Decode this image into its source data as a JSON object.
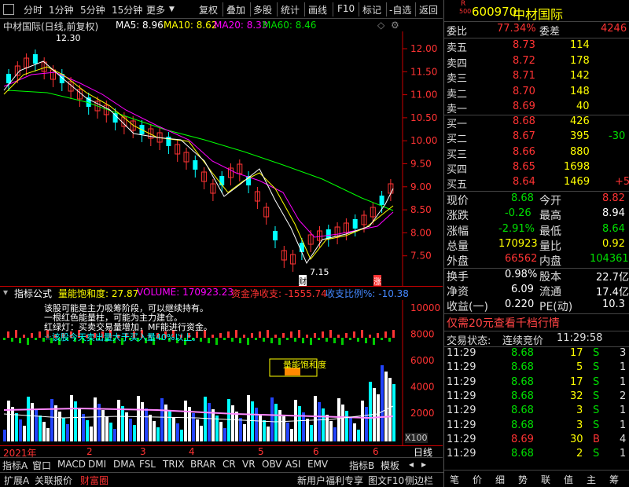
{
  "toolbar": {
    "periods": [
      "分时",
      "1分钟",
      "5分钟",
      "15分钟",
      "更多"
    ],
    "actions": [
      "复权",
      "叠加",
      "多股",
      "统计",
      "画线",
      "F10",
      "标记",
      "-自选",
      "返回"
    ]
  },
  "chart": {
    "stock_label": "中材国际(日线,前复权)",
    "ma5": "MA5: 8.96",
    "ma10": "MA10: 8.62",
    "ma20": "MA20: 8.33",
    "ma60": "MA60: 8.46",
    "high_note": "12.30",
    "low_note": "7.15",
    "fin_tag": "财",
    "up_tag": "涨",
    "y_ticks": [
      "12.00",
      "11.50",
      "11.00",
      "10.50",
      "10.00",
      "9.50",
      "9.00",
      "8.50",
      "8.00",
      "7.50"
    ],
    "dates": [
      "2021年",
      "2",
      "3",
      "4",
      "5",
      "6"
    ],
    "period": "日线",
    "colors": {
      "ma5": "#ffffff",
      "ma10": "#ffff00",
      "ma20": "#ff00ff",
      "ma60": "#00ff00",
      "up": "#ff3333",
      "down": "#00ffff"
    }
  },
  "chart_data": {
    "type": "candlestick",
    "series": [
      {
        "name": "MA5",
        "last": 8.96
      },
      {
        "name": "MA10",
        "last": 8.62
      },
      {
        "name": "MA20",
        "last": 8.33
      },
      {
        "name": "MA60",
        "last": 8.46
      }
    ],
    "high": 12.3,
    "low": 7.15,
    "ylim": [
      7.15,
      12.3
    ]
  },
  "indicator": {
    "label": "指标公式",
    "saturation": "量能饱和度: 27.87",
    "volume": "VOLUME: 170923.23",
    "netflow": "资金净收支: -1555.74",
    "ratio": "收支比例%: -10.38",
    "notes": [
      "该股可能是主力吸筹阶段，可以继续持有。",
      "一根红色能量柱，可能为主力建仓。",
      "红绿灯：买卖交易量增加，MF能进行资金。",
      "☆该股今天卖出量大于买入量40%以上。"
    ],
    "box_label": "量能饱和度",
    "y_ticks": [
      "10000",
      "8000",
      "6000",
      "4000",
      "2000"
    ],
    "unit": "X100"
  },
  "tabs": [
    "指标A",
    "窗口",
    "MACD",
    "DMI",
    "DMA",
    "FSL",
    "TRIX",
    "BRAR",
    "CR",
    "VR",
    "OBV",
    "ASI",
    "EMV"
  ],
  "tabs_right": [
    "指标B",
    "模板"
  ],
  "bottom": [
    "扩展A",
    "关联报价",
    "财富圈"
  ],
  "bottom_right": [
    "新用户福利专享",
    "图文F10",
    "侧边栏"
  ],
  "right": {
    "code": "600970",
    "name": "中材国际",
    "r_tag": "R",
    "num_tag": "500",
    "weibi_label": "委比",
    "weibi": "77.34%",
    "weicha_label": "委差",
    "weicha": "4246",
    "sell": [
      {
        "l": "卖五",
        "p": "8.73",
        "v": "114"
      },
      {
        "l": "卖四",
        "p": "8.72",
        "v": "178"
      },
      {
        "l": "卖三",
        "p": "8.71",
        "v": "142"
      },
      {
        "l": "卖二",
        "p": "8.70",
        "v": "148"
      },
      {
        "l": "卖一",
        "p": "8.69",
        "v": "40"
      }
    ],
    "buy": [
      {
        "l": "买一",
        "p": "8.68",
        "v": "426",
        "c": ""
      },
      {
        "l": "买二",
        "p": "8.67",
        "v": "395",
        "c": "-30"
      },
      {
        "l": "买三",
        "p": "8.66",
        "v": "880",
        "c": ""
      },
      {
        "l": "买四",
        "p": "8.65",
        "v": "1698",
        "c": ""
      },
      {
        "l": "买五",
        "p": "8.64",
        "v": "1469",
        "c": "+5"
      }
    ],
    "stats": [
      {
        "a": "现价",
        "b": "8.68",
        "c": "今开",
        "d": "8.82"
      },
      {
        "a": "涨跌",
        "b": "-0.26",
        "c": "最高",
        "d": "8.94"
      },
      {
        "a": "涨幅",
        "b": "-2.91%",
        "c": "最低",
        "d": "8.64"
      },
      {
        "a": "总量",
        "b": "170923",
        "c": "量比",
        "d": "0.92"
      },
      {
        "a": "外盘",
        "b": "66562",
        "c": "内盘",
        "d": "104361"
      }
    ],
    "stats2": [
      {
        "a": "换手",
        "b": "0.98%",
        "c": "股本",
        "d": "22.7亿"
      },
      {
        "a": "净资",
        "b": "6.09",
        "c": "流通",
        "d": "17.4亿"
      },
      {
        "a": "收益(一)",
        "b": "0.220",
        "c": "PE(动)",
        "d": "10.3"
      }
    ],
    "promo": "仅需20元查看千档行情",
    "status_label": "交易状态:",
    "status": "连续竞价",
    "time": "11:29:58",
    "ticks": [
      {
        "t": "11:29",
        "p": "8.68",
        "v": "17",
        "s": "S",
        "n": "3"
      },
      {
        "t": "11:29",
        "p": "8.68",
        "v": "5",
        "s": "S",
        "n": "1"
      },
      {
        "t": "11:29",
        "p": "8.68",
        "v": "17",
        "s": "S",
        "n": "1"
      },
      {
        "t": "11:29",
        "p": "8.68",
        "v": "32",
        "s": "S",
        "n": "2"
      },
      {
        "t": "11:29",
        "p": "8.68",
        "v": "3",
        "s": "S",
        "n": "1"
      },
      {
        "t": "11:29",
        "p": "8.68",
        "v": "3",
        "s": "S",
        "n": "1"
      },
      {
        "t": "11:29",
        "p": "8.69",
        "v": "30",
        "s": "B",
        "n": "4"
      },
      {
        "t": "11:29",
        "p": "8.68",
        "v": "2",
        "s": "S",
        "n": "1"
      }
    ],
    "bottom_tabs": [
      "笔",
      "价",
      "细",
      "势",
      "联",
      "值",
      "主",
      "筹"
    ]
  }
}
